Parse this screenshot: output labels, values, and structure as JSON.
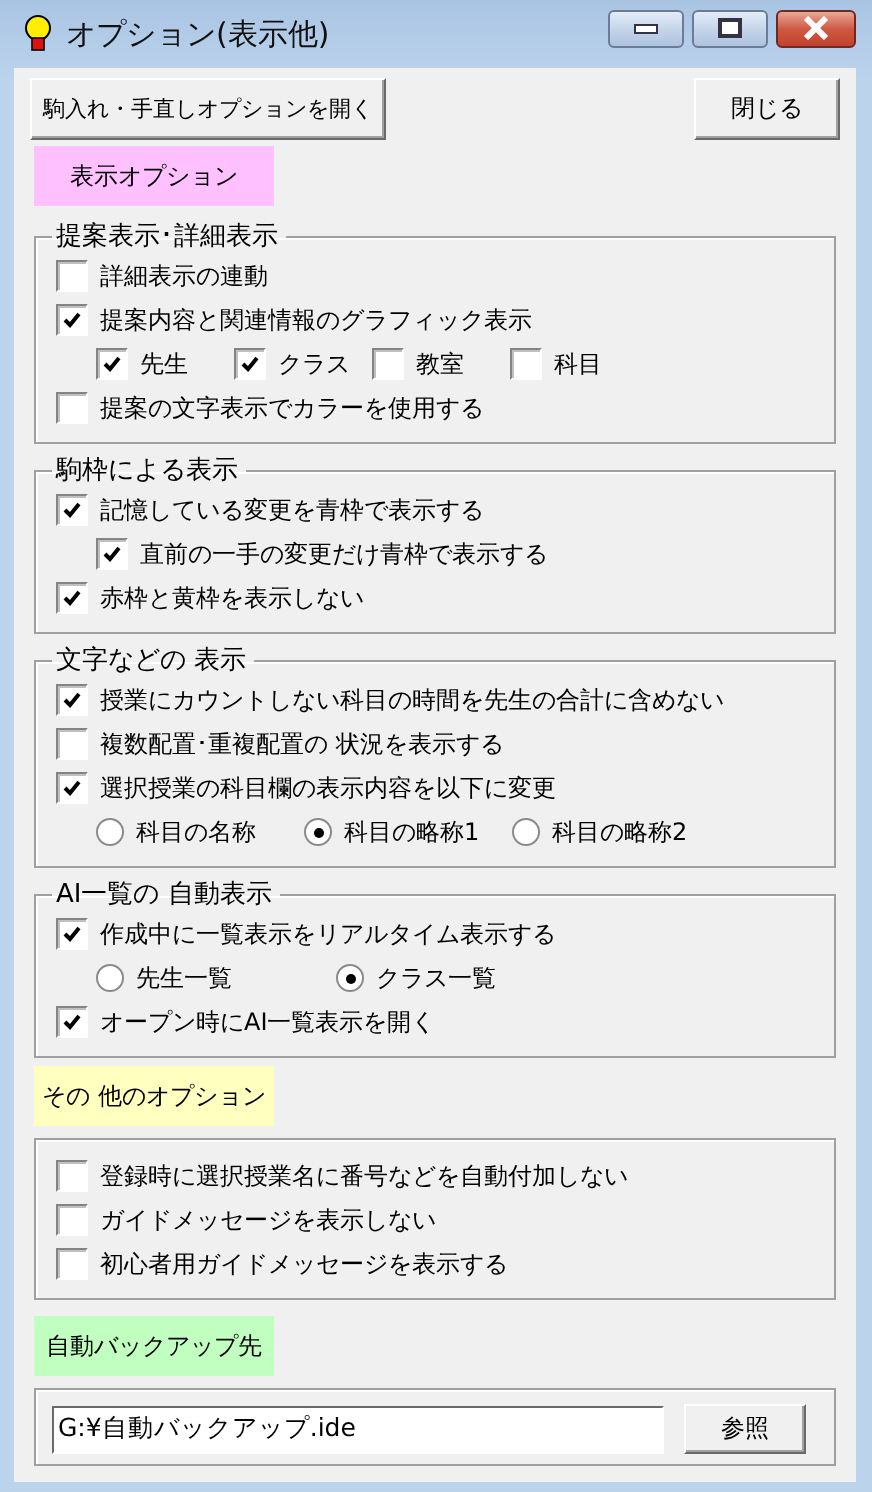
{
  "window": {
    "title": "オプション(表示他)"
  },
  "top_buttons": [
    {
      "label": "駒入れ・手直しオプションを開く"
    },
    {
      "label": "閉じる"
    }
  ],
  "sections": [
    {
      "kind": "header",
      "label": "表示オプション",
      "color": "#ffc0ff"
    },
    {
      "kind": "group",
      "title": "提案表示･詳細表示",
      "items": [
        {
          "kind": "checkbox",
          "label": "詳細表示の連動",
          "checked": false
        },
        {
          "kind": "checkbox",
          "label": "提案内容と関連情報のグラフィック表示",
          "checked": true,
          "children": [
            {
              "kind": "checkbox_row",
              "options": [
                {
                  "label": "先生",
                  "checked": true
                },
                {
                  "label": "クラス",
                  "checked": true
                },
                {
                  "label": "教室",
                  "checked": false
                },
                {
                  "label": "科目",
                  "checked": false
                }
              ]
            }
          ]
        },
        {
          "kind": "checkbox",
          "label": "提案の文字表示でカラーを使用する",
          "checked": false
        }
      ]
    },
    {
      "kind": "group",
      "title": "駒枠による表示",
      "items": [
        {
          "kind": "checkbox",
          "label": "記憶している変更を青枠で表示する",
          "checked": true,
          "children": [
            {
              "kind": "checkbox",
              "label": "直前の一手の変更だけ青枠で表示する",
              "checked": true
            }
          ]
        },
        {
          "kind": "checkbox",
          "label": "赤枠と黄枠を表示しない",
          "checked": true
        }
      ]
    },
    {
      "kind": "group",
      "title": "文字などの 表示",
      "items": [
        {
          "kind": "checkbox",
          "label": "授業にカウントしない科目の時間を先生の合計に含めない",
          "checked": true
        },
        {
          "kind": "checkbox",
          "label": "複数配置･重複配置の 状況を表示する",
          "checked": false
        },
        {
          "kind": "checkbox",
          "label": "選択授業の科目欄の表示内容を以下に変更",
          "checked": true,
          "children": [
            {
              "kind": "radio_row",
              "options": [
                {
                  "label": "科目の名称",
                  "selected": false
                },
                {
                  "label": "科目の略称1",
                  "selected": true
                },
                {
                  "label": "科目の略称2",
                  "selected": false
                }
              ]
            }
          ]
        }
      ]
    },
    {
      "kind": "group",
      "title": "AI一覧の 自動表示",
      "items": [
        {
          "kind": "checkbox",
          "label": "作成中に一覧表示をリアルタイム表示する",
          "checked": true,
          "children": [
            {
              "kind": "radio_row",
              "options": [
                {
                  "label": "先生一覧",
                  "selected": false
                },
                {
                  "label": "クラス一覧",
                  "selected": true
                }
              ]
            }
          ]
        },
        {
          "kind": "checkbox",
          "label": "オープン時にAI一覧表示を開く",
          "checked": true
        }
      ]
    },
    {
      "kind": "header",
      "label": "その 他のオプション",
      "color": "#ffffc0"
    },
    {
      "kind": "group",
      "items": [
        {
          "kind": "checkbox",
          "label": "登録時に選択授業名に番号などを自動付加しない",
          "checked": false
        },
        {
          "kind": "checkbox",
          "label": "ガイドメッセージを表示しない",
          "checked": false
        },
        {
          "kind": "checkbox",
          "label": "初心者用ガイドメッセージを表示する",
          "checked": false
        }
      ]
    },
    {
      "kind": "header",
      "label": "自動バックアップ先",
      "color": "#c0ffc0"
    },
    {
      "kind": "path",
      "value": "G:¥自動バックアップ.ide",
      "button": "参照"
    }
  ]
}
